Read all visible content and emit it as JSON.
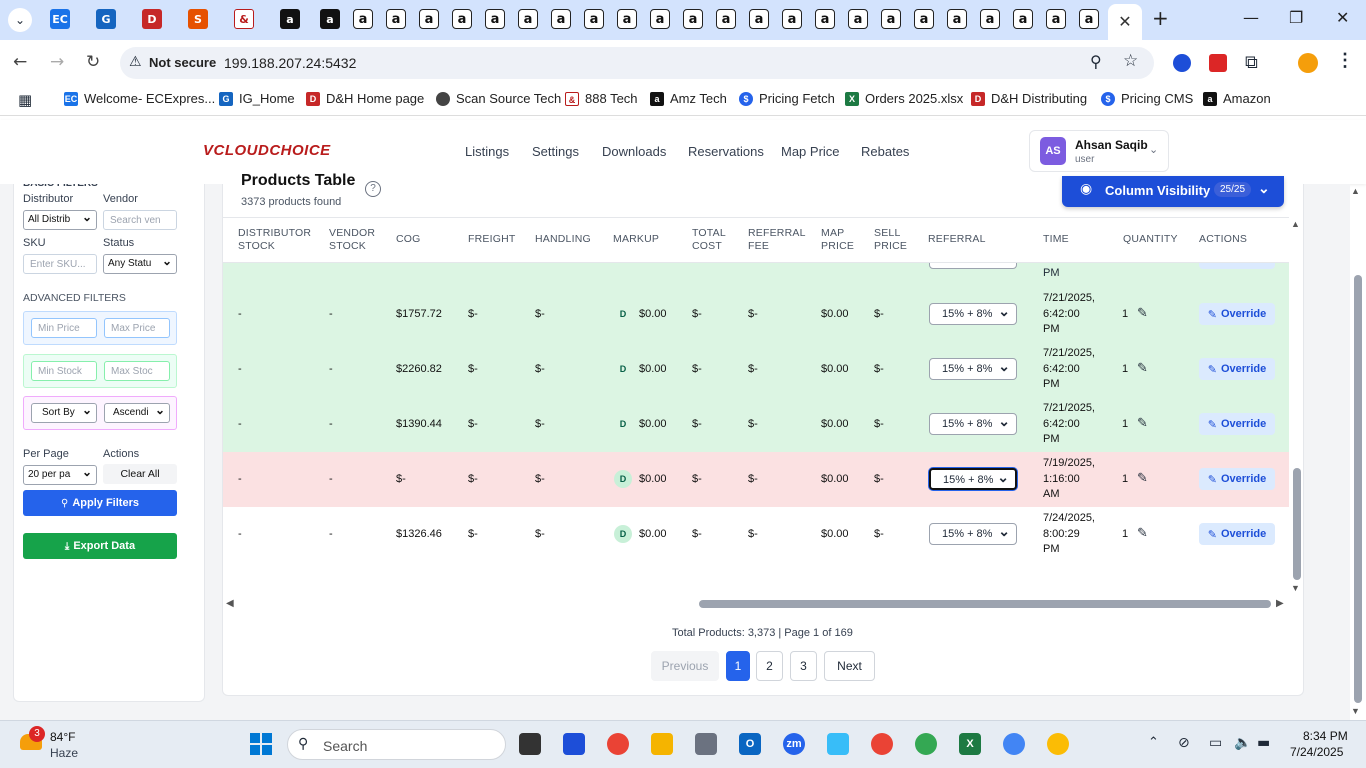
{
  "browser": {
    "address": "199.188.207.24:5432",
    "security_label": "Not secure",
    "bookmarks": [
      "Welcome- ECExpres...",
      "IG_Home",
      "D&H Home page",
      "Scan Source Tech",
      "888 Tech",
      "Amz Tech",
      "Pricing Fetch",
      "Orders 2025.xlsx",
      "D&H Distributing",
      "Pricing CMS",
      "Amazon"
    ]
  },
  "app": {
    "logo": "VCLOUDCHOICE",
    "nav": [
      "Listings",
      "Settings",
      "Downloads",
      "Reservations",
      "Map Price",
      "Rebates"
    ],
    "user": {
      "initials": "AS",
      "name": "Ahsan Saqib",
      "role": "user"
    }
  },
  "sidebar": {
    "partial_heading": "BASIC FILTERS",
    "distributor_label": "Distributor",
    "distributor_value": "All Distrib",
    "vendor_label": "Vendor",
    "vendor_placeholder": "Search ven",
    "sku_label": "SKU",
    "sku_placeholder": "Enter SKU...",
    "status_label": "Status",
    "status_value": "Any Statu",
    "advanced_heading": "ADVANCED FILTERS",
    "min_price": "Min Price",
    "max_price": "Max Price",
    "min_stock": "Min Stock",
    "max_stock": "Max Stoc",
    "sort_by": "Sort By",
    "sort_order": "Ascendi",
    "per_page_label": "Per Page",
    "per_page_value": "20 per pa",
    "actions_label": "Actions",
    "clear_all": "Clear All",
    "apply_filters": "Apply Filters",
    "export_data": "Export Data"
  },
  "table": {
    "title": "Products Table",
    "count_text": "3373 products found",
    "column_visibility": "Column Visibility",
    "column_count": "25/25",
    "headers": [
      [
        "DISTRIBUTOR",
        "STOCK"
      ],
      [
        "VENDOR",
        "STOCK"
      ],
      [
        "COG",
        ""
      ],
      [
        "FREIGHT",
        ""
      ],
      [
        "HANDLING",
        ""
      ],
      [
        "MARKUP",
        ""
      ],
      [
        "TOTAL",
        "COST"
      ],
      [
        "REFERRAL",
        "FEE"
      ],
      [
        "MAP",
        "PRICE"
      ],
      [
        "SELL",
        "PRICE"
      ],
      [
        "REFERRAL",
        ""
      ],
      [
        "TIME",
        ""
      ],
      [
        "QUANTITY",
        ""
      ],
      [
        "ACTIONS",
        ""
      ]
    ],
    "rows": [
      {
        "dist": "-",
        "vend": "-",
        "cog": "$1757.72",
        "freight": "$-",
        "handling": "$-",
        "badge": "D",
        "markup": "$0.00",
        "total": "$-",
        "fee": "$-",
        "map": "$0.00",
        "sell": "$-",
        "referral": "15% + 8%",
        "time1": "7/21/2025,",
        "time2": "6:42:00",
        "time3": "PM",
        "qty": "1",
        "action": "Override",
        "bg": "#dcf5e3"
      },
      {
        "dist": "-",
        "vend": "-",
        "cog": "$2260.82",
        "freight": "$-",
        "handling": "$-",
        "badge": "D",
        "markup": "$0.00",
        "total": "$-",
        "fee": "$-",
        "map": "$0.00",
        "sell": "$-",
        "referral": "15% + 8%",
        "time1": "7/21/2025,",
        "time2": "6:42:00",
        "time3": "PM",
        "qty": "1",
        "action": "Override",
        "bg": "#dcf5e3"
      },
      {
        "dist": "-",
        "vend": "-",
        "cog": "$1390.44",
        "freight": "$-",
        "handling": "$-",
        "badge": "D",
        "markup": "$0.00",
        "total": "$-",
        "fee": "$-",
        "map": "$0.00",
        "sell": "$-",
        "referral": "15% + 8%",
        "time1": "7/21/2025,",
        "time2": "6:42:00",
        "time3": "PM",
        "qty": "1",
        "action": "Override",
        "bg": "#dcf5e3"
      },
      {
        "dist": "-",
        "vend": "-",
        "cog": "$-",
        "freight": "$-",
        "handling": "$-",
        "badge": "D",
        "markup": "$0.00",
        "total": "$-",
        "fee": "$-",
        "map": "$0.00",
        "sell": "$-",
        "referral": "15% + 8%",
        "time1": "7/19/2025,",
        "time2": "1:16:00",
        "time3": "AM",
        "qty": "1",
        "action": "Override",
        "bg": "#fbe1e2"
      },
      {
        "dist": "-",
        "vend": "-",
        "cog": "$1326.46",
        "freight": "$-",
        "handling": "$-",
        "badge": "D",
        "markup": "$0.00",
        "total": "$-",
        "fee": "$-",
        "map": "$0.00",
        "sell": "$-",
        "referral": "15% + 8%",
        "time1": "7/24/2025,",
        "time2": "8:00:29",
        "time3": "PM",
        "qty": "1",
        "action": "Override",
        "bg": "#ffffff"
      }
    ],
    "summary": "Total Products: 3,373 | Page 1 of 169",
    "pagination": {
      "previous": "Previous",
      "pages": [
        "1",
        "2",
        "3"
      ],
      "next": "Next"
    }
  },
  "taskbar": {
    "weather_temp": "84°F",
    "weather_desc": "Haze",
    "weather_badge": "3",
    "search": "Search",
    "time": "8:34 PM",
    "date": "7/24/2025"
  }
}
